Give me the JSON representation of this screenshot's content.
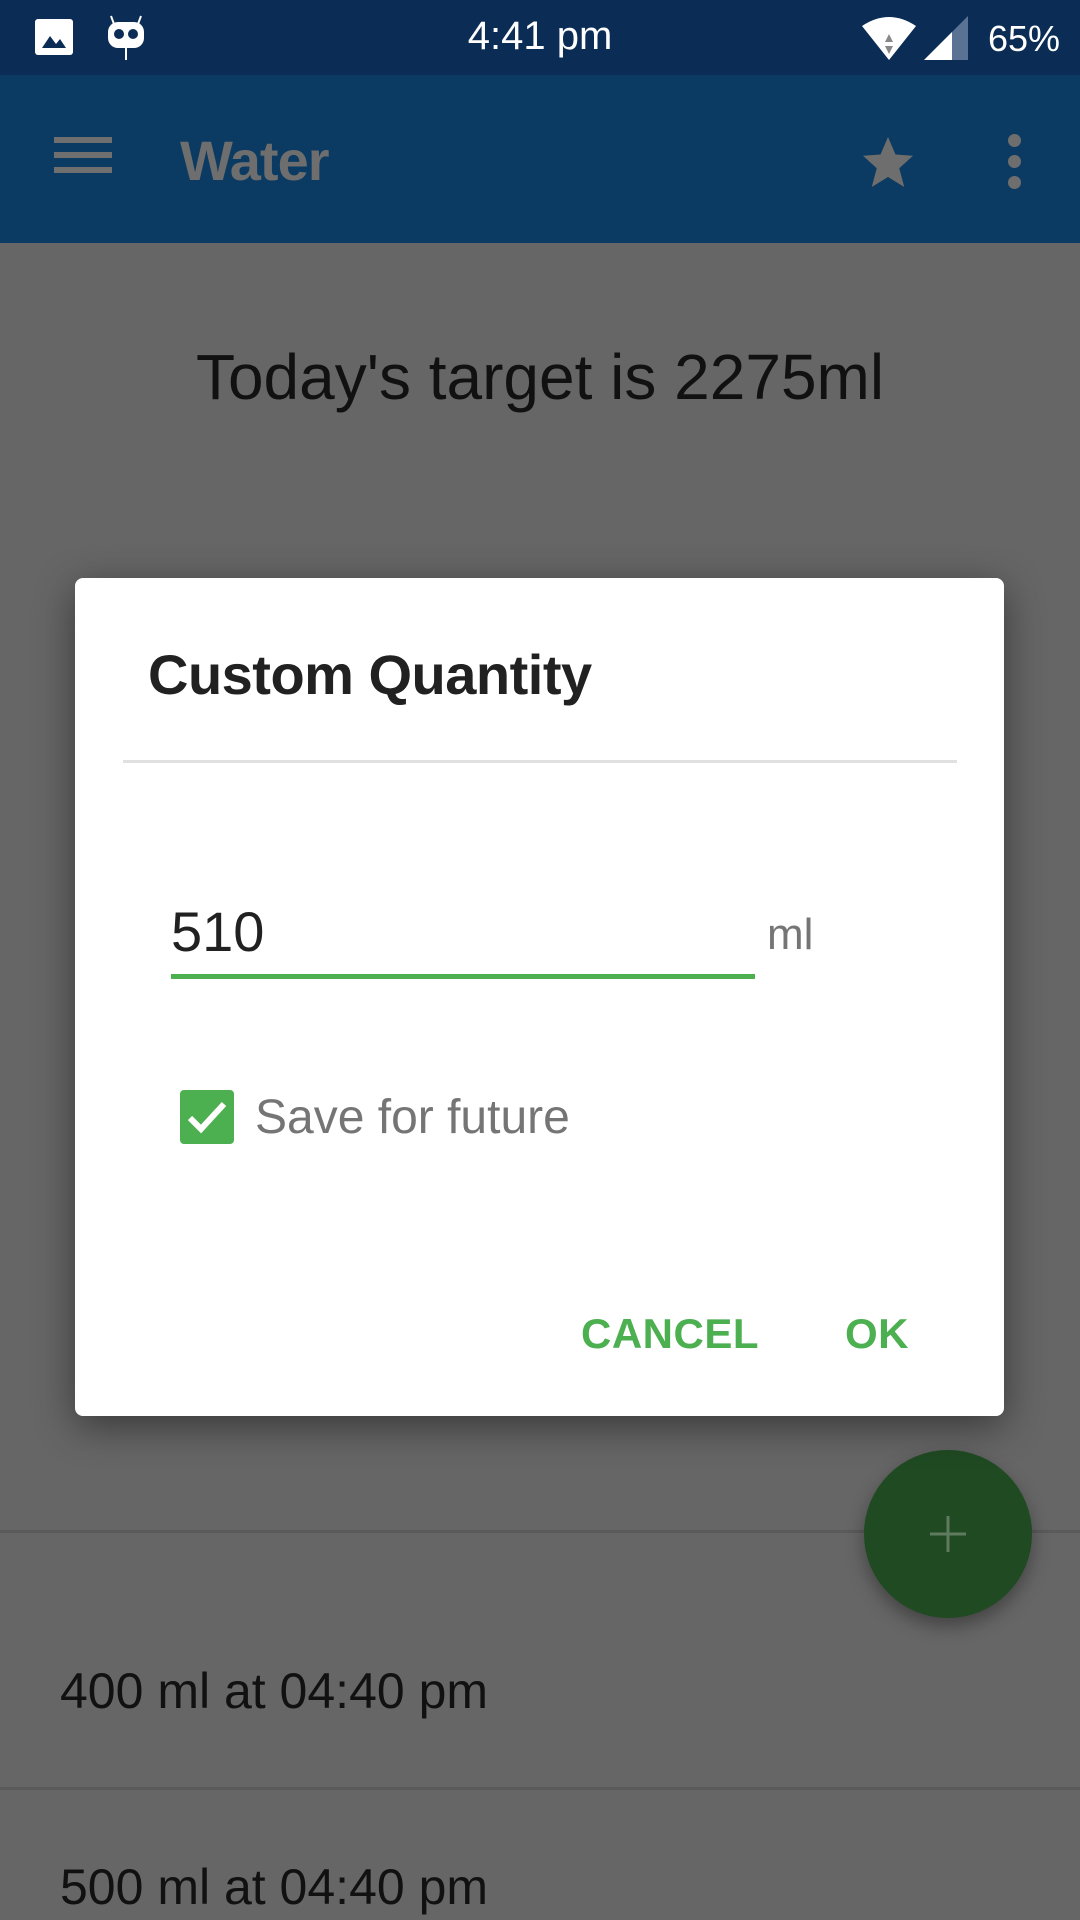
{
  "status_bar": {
    "time": "4:41 pm",
    "battery": "65%",
    "icons": [
      "gallery-icon",
      "cyanogenmod-icon",
      "wifi-icon",
      "signal-icon"
    ]
  },
  "app_bar": {
    "title": "Water",
    "icons": [
      "menu-icon",
      "star-icon",
      "more-vert-icon"
    ]
  },
  "main": {
    "target_text": "Today's target is 2275ml",
    "history": [
      {
        "text": "400 ml at 04:40 pm"
      },
      {
        "text": "500 ml at 04:40 pm"
      }
    ],
    "fab_icon": "plus-icon"
  },
  "dialog": {
    "title": "Custom Quantity",
    "quantity_value": "510",
    "unit": "ml",
    "save_checkbox": {
      "label": "Save for future",
      "checked": true
    },
    "cancel_label": "CANCEL",
    "ok_label": "OK"
  },
  "colors": {
    "status_bar": "#0b2d55",
    "accent": "#4caf50",
    "scrim": "#666666"
  }
}
